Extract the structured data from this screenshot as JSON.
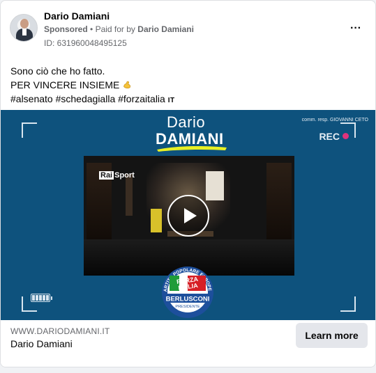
{
  "header": {
    "page_name": "Dario Damiani",
    "sponsored_label": "Sponsored",
    "separator": "•",
    "paid_for_text": "Paid for by",
    "payer": "Dario Damiani",
    "ad_id": "ID: 631960048495125",
    "more_icon": "more-options-icon",
    "more_label": "···"
  },
  "post": {
    "line1": "Sono ciò che ho fatto.",
    "line2": "PER VINCERE INSIEME",
    "line2_emoji": "flexed-biceps-icon",
    "line3": "#alsenato #schedagialla #forzaitalia",
    "line3_flag": "IT"
  },
  "media": {
    "brand_first": "Dario",
    "brand_last": "DAMIANI",
    "resp_text": "comm. resp. GIOVANNI CETO",
    "rec_label": "REC",
    "channel_logo_rai": "Rai",
    "channel_logo_sport": "Sport",
    "play_icon": "play-icon",
    "party_logo": {
      "arc_text": "PARTITO POPOLARE EUROPEO",
      "line1": "FORZA",
      "line2": "ITALIA",
      "line3": "BERLUSCONI",
      "line4": "PRESIDENTE"
    },
    "colors": {
      "background": "#0e527d",
      "accent_yellow": "#e8f024",
      "rec_dot": "#e0337c"
    }
  },
  "footer": {
    "domain": "WWW.DARIODAMIANI.IT",
    "title": "Dario Damiani",
    "cta_label": "Learn more"
  }
}
